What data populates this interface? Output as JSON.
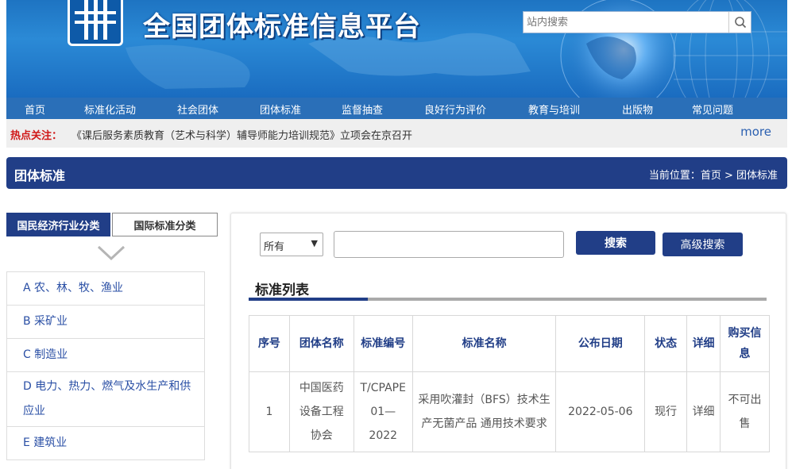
{
  "header": {
    "site_title": "全国团体标准信息平台",
    "search_placeholder": "站内搜索"
  },
  "nav": [
    "首页",
    "标准化活动",
    "社会团体",
    "团体标准",
    "监督抽查",
    "良好行为评价",
    "教育与培训",
    "出版物",
    "常见问题"
  ],
  "hot": {
    "label": "热点关注：",
    "text": "《课后服务素质教育（艺术与科学）辅导师能力培训规范》立项会在京召开",
    "more": "more"
  },
  "section": {
    "title": "团体标准",
    "breadcrumb": "当前位置：首页 > 团体标准"
  },
  "left_tabs": [
    "国民经济行业分类",
    "国际标准分类"
  ],
  "categories": [
    "A 农、林、牧、渔业",
    "B 采矿业",
    "C 制造业",
    "D 电力、热力、燃气及水生产和供应业",
    "E 建筑业"
  ],
  "search": {
    "select_value": "所有",
    "search_btn": "搜索",
    "advanced_btn": "高级搜索"
  },
  "list_title": "标准列表",
  "table": {
    "headers": [
      "序号",
      "团体名称",
      "标准编号",
      "标准名称",
      "公布日期",
      "状态",
      "详细",
      "购买信息"
    ],
    "rows": [
      {
        "no": "1",
        "org": "中国医药设备工程协会",
        "code": "T/CPAPE 01—2022",
        "name": "采用吹灌封（BFS）技术生产无菌产品 通用技术要求",
        "date": "2022-05-06",
        "status": "现行",
        "detail": "详细",
        "buy": "不可出售"
      }
    ]
  },
  "colors": {
    "nav_bg": "#2a6fb8",
    "accent_dark": "#213e87",
    "hot_label": "#d01818"
  }
}
